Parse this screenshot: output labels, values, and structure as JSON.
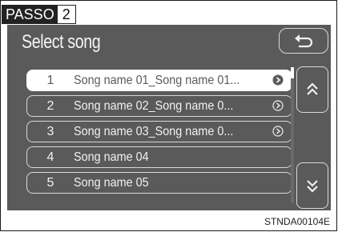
{
  "badge": {
    "label": "PASSO",
    "number": "2"
  },
  "screen": {
    "title": "Select song",
    "back_icon": "return-arrow-icon",
    "songs": [
      {
        "index": "1",
        "name": "Song name 01_Song name 01...",
        "has_arrow": true,
        "selected": true
      },
      {
        "index": "2",
        "name": "Song name 02_Song name 0...",
        "has_arrow": true,
        "selected": false
      },
      {
        "index": "3",
        "name": "Song name 03_Song name 0...",
        "has_arrow": true,
        "selected": false
      },
      {
        "index": "4",
        "name": "Song name 04",
        "has_arrow": false,
        "selected": false
      },
      {
        "index": "5",
        "name": "Song name 05",
        "has_arrow": false,
        "selected": false
      }
    ],
    "page_up_icon": "double-chevron-up-icon",
    "page_down_icon": "double-chevron-down-icon"
  },
  "figure_code": "STNDA00104E",
  "colors": {
    "screen_bg": "#5a5a5a",
    "row_border": "#d8d8d8",
    "selected_bg": "#ffffff"
  }
}
